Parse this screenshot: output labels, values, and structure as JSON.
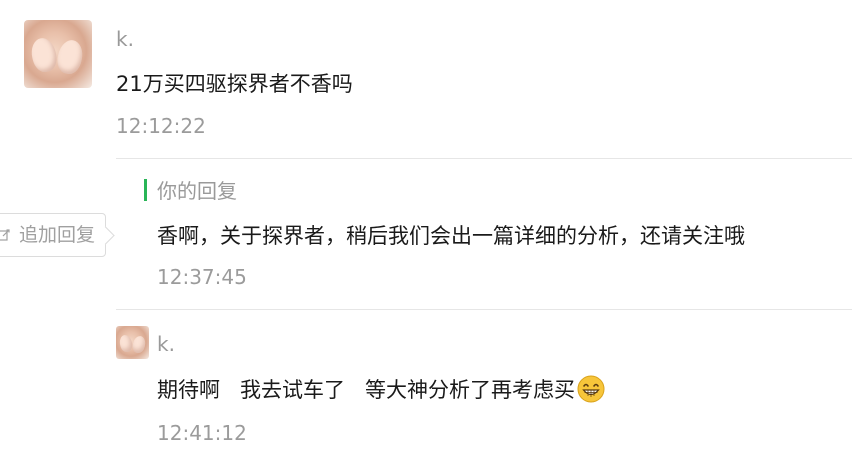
{
  "comment": {
    "nickname": "k.",
    "text": "21万买四驱探界者不香吗",
    "time": "12:12:22"
  },
  "reply": {
    "header": "你的回复",
    "text": "香啊，关于探界者，稍后我们会出一篇详细的分析，还请关注哦",
    "time": "12:37:45"
  },
  "follow_up": {
    "nickname": "k.",
    "text": "期待啊   我去试车了   等大神分析了再考虑买",
    "emoji": "grinning-face-emoji",
    "time": "12:41:12"
  },
  "action": {
    "add_reply_label": "追加回复",
    "icon": "edit-icon"
  },
  "colors": {
    "accent_green": "#29b557",
    "muted_text": "#999999",
    "divider": "#e6e6e6"
  }
}
